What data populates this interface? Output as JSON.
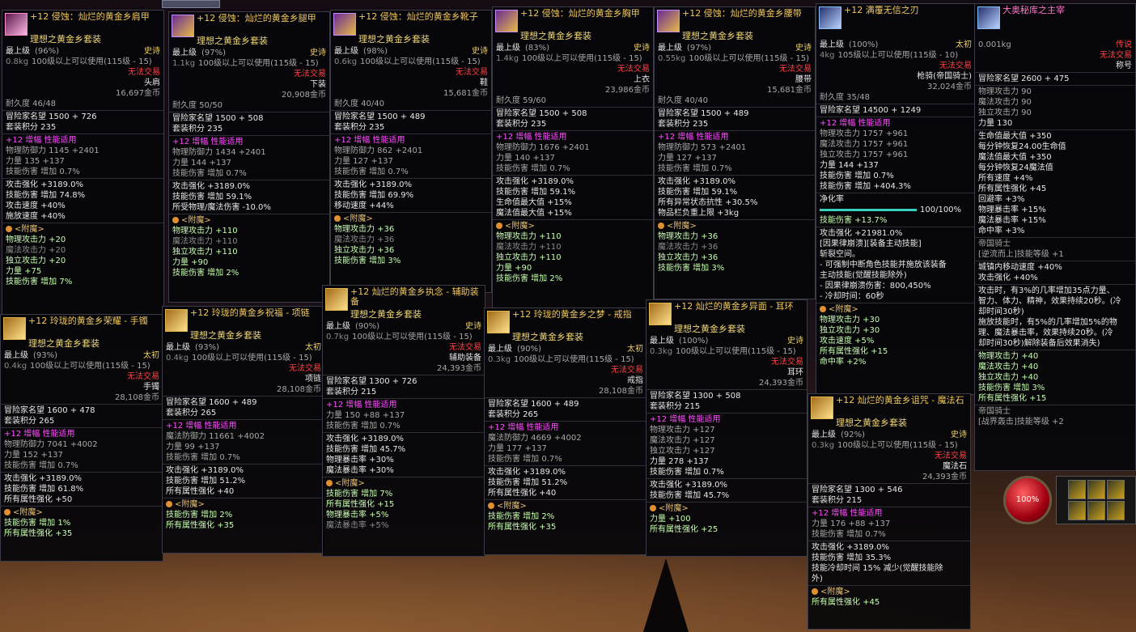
{
  "hud": {
    "hp_percent": "100%"
  },
  "items": [
    {
      "name": "+12 侵蚀：灿烂的黄金乡肩甲",
      "set": "理想之黄金乡套装",
      "level": "最上级",
      "quality": "(96%)",
      "grade": "史诗",
      "weight": "0.8kg",
      "req": "100级以上可以使用(115级 - 15)",
      "trade": "无法交易",
      "slot": "头肩",
      "price": "16,697金币",
      "durability": "耐久度 46/48",
      "fame": "冒险家名望 1500 + 726",
      "setpts": "套装积分 235",
      "amp_head": "+12 增幅  性能适用",
      "stats": [
        "物理防御力 1145 +2401",
        "力量 135 +137",
        "技能伤害 增加 0.7%"
      ],
      "attrs": [
        "攻击强化 +3189.0%",
        "技能伤害 增加 74.8%",
        "攻击速度 +40%",
        "施放速度 +40%"
      ],
      "ench_title": "<附魔>",
      "ench": [
        "物理攻击力 +20",
        "魔法攻击力 +20",
        "独立攻击力 +20",
        "力量 +75",
        "技能伤害 增加 7%"
      ]
    },
    {
      "name": "+12 侵蚀：灿烂的黄金乡腿甲",
      "set": "理想之黄金乡套装",
      "level": "最上级",
      "quality": "(97%)",
      "grade": "史诗",
      "weight": "1.1kg",
      "req": "100级以上可以使用(115级 - 15)",
      "trade": "无法交易",
      "slot": "下装",
      "price": "20,908金币",
      "durability": "耐久度 50/50",
      "fame": "冒险家名望 1500 + 508",
      "setpts": "套装积分 235",
      "amp_head": "+12 增幅  性能适用",
      "stats": [
        "物理防御力 1434 +2401",
        "力量 144 +137",
        "技能伤害 增加 0.7%"
      ],
      "attrs": [
        "攻击强化 +3189.0%",
        "技能伤害 增加 59.1%",
        "所受物理/魔法伤害 -10.0%"
      ],
      "ench_title": "<附魔>",
      "ench": [
        "物理攻击力 +110",
        "魔法攻击力 +110",
        "独立攻击力 +110",
        "力量 +90",
        "技能伤害 增加 2%"
      ]
    },
    {
      "name": "+12 侵蚀：灿烂的黄金乡靴子",
      "set": "理想之黄金乡套装",
      "level": "最上级",
      "quality": "(98%)",
      "grade": "史诗",
      "weight": "0.6kg",
      "req": "100级以上可以使用(115级 - 15)",
      "trade": "无法交易",
      "slot": "鞋",
      "price": "15,681金币",
      "durability": "耐久度 40/40",
      "fame": "冒险家名望 1500 + 489",
      "setpts": "套装积分 235",
      "amp_head": "+12 增幅  性能适用",
      "stats": [
        "物理防御力 862 +2401",
        "力量 127 +137",
        "技能伤害 增加 0.7%"
      ],
      "attrs": [
        "攻击强化 +3189.0%",
        "技能伤害 增加 69.9%",
        "移动速度 +44%"
      ],
      "ench_title": "<附魔>",
      "ench": [
        "物理攻击力 +36",
        "魔法攻击力 +36",
        "独立攻击力 +36",
        "技能伤害 增加 3%"
      ]
    },
    {
      "name": "+12 侵蚀：灿烂的黄金乡胸甲",
      "set": "理想之黄金乡套装",
      "level": "最上级",
      "quality": "(83%)",
      "grade": "史诗",
      "weight": "1.4kg",
      "req": "100级以上可以使用(115级 - 15)",
      "trade": "无法交易",
      "slot": "上衣",
      "price": "23,986金币",
      "durability": "耐久度 59/60",
      "fame": "冒险家名望 1500 + 508",
      "setpts": "套装积分 235",
      "amp_head": "+12 增幅  性能适用",
      "stats": [
        "物理防御力 1676 +2401",
        "力量 140 +137",
        "技能伤害 增加 0.7%"
      ],
      "attrs": [
        "攻击强化 +3189.0%",
        "技能伤害 增加 59.1%",
        "生命值最大值 +15%",
        "魔法值最大值 +15%"
      ],
      "ench_title": "<附魔>",
      "ench": [
        "物理攻击力 +110",
        "魔法攻击力 +110",
        "独立攻击力 +110",
        "力量 +90",
        "技能伤害 增加 2%"
      ]
    },
    {
      "name": "+12 侵蚀：灿烂的黄金乡腰带",
      "set": "理想之黄金乡套装",
      "level": "最上级",
      "quality": "(97%)",
      "grade": "史诗",
      "weight": "0.55kg",
      "req": "100级以上可以使用(115级 - 15)",
      "trade": "无法交易",
      "slot": "腰带",
      "price": "15,681金币",
      "durability": "耐久度 40/40",
      "fame": "冒险家名望 1500 + 489",
      "setpts": "套装积分 235",
      "amp_head": "+12 增幅  性能适用",
      "stats": [
        "物理防御力 573 +2401",
        "力量 127 +137",
        "技能伤害 增加 0.7%"
      ],
      "attrs": [
        "攻击强化 +3189.0%",
        "技能伤害 增加 59.1%",
        "所有异常状态抗性 +30.5%",
        "物品栏负重上限 +3kg"
      ],
      "ench_title": "<附魔>",
      "ench": [
        "物理攻击力 +36",
        "魔法攻击力 +36",
        "独立攻击力 +36",
        "技能伤害 增加 3%"
      ]
    },
    {
      "name": "+12 满覆无信之刃",
      "set": "",
      "level": "最上级",
      "quality": "(100%)",
      "grade": "太初",
      "weight": "4kg",
      "req": "105级以上可以使用(115级 - 10)",
      "trade": "无法交易",
      "slot": "枪骑(帝国骑士)",
      "price": "32,024金币",
      "durability": "耐久度 35/48",
      "fame": "冒险家名望 14500 + 1249",
      "amp_head": "+12 增幅  性能适用",
      "stats": [
        "物理攻击力 1757 +961",
        "魔法攻击力 1757 +961",
        "独立攻击力 1757 +961",
        "力量 144 +137",
        "技能伤害 增加 0.7%",
        "技能伤害 增加 +404.3%"
      ],
      "purify": "净化率",
      "purify_val": "100/100%",
      "purify_skill": "技能伤害 +13.7%",
      "attrs": [
        "攻击强化 +21981.0%",
        "[因果律崩溃][装备主动技能]",
        "斩裂空间。",
        "- 可强制中断角色技能并施放该装备",
        "主动技能(觉醒技能除外)",
        "- 因果律崩溃伤害：800,450%",
        "- 冷却时间：60秒"
      ],
      "ench_title": "<附魔>",
      "ench": [
        "物理攻击力 +30",
        "独立攻击力 +30",
        "攻击速度 +5%",
        "所有属性强化 +15",
        "命中率 +2%"
      ]
    },
    {
      "name": "大奥秘库之主宰",
      "grade": "传说",
      "weight": "0.001kg",
      "trade": "无法交易",
      "slot": "称号",
      "fame": "冒险家名望 2600 + 475",
      "stats": [
        "物理攻击力 90",
        "魔法攻击力 90",
        "独立攻击力 90",
        "力量 130"
      ],
      "attrs": [
        "生命值最大值 +350",
        "每分钟恢复24.00生命值",
        "魔法值最大值 +350",
        "每分钟恢复24魔法值",
        "所有速度 +4%",
        "所有属性强化 +45",
        "回避率 +3%",
        "物理暴击率 +15%",
        "魔法暴击率 +15%",
        "命中率 +3%"
      ],
      "class1": "帝国骑士",
      "class1_skill": "[逆流而上]技能等级 +1",
      "town": [
        "城镇内移动速度 +40%",
        "攻击强化 +40%"
      ],
      "proc": [
        "攻击时，有3%的几率增加35点力量、",
        "智力、体力、精神，效果持续20秒。(冷",
        "却时间30秒)",
        "施放技能时，有5%的几率增加5%的物",
        "理、魔法暴击率，效果持续20秒。(冷",
        "却时间30秒)解除装备后效果消失)"
      ],
      "ench": [
        "物理攻击力 +40",
        "魔法攻击力 +40",
        "独立攻击力 +40",
        "技能伤害 增加 3%",
        "所有属性强化 +15"
      ],
      "class2": "帝国骑士",
      "class2_skill": "[战界轰击]技能等级 +2"
    },
    {
      "name": "+12 玲珑的黄金乡荣耀 - 手镯",
      "set": "理想之黄金乡套装",
      "level": "最上级",
      "quality": "(93%)",
      "grade": "太初",
      "weight": "0.4kg",
      "req": "100级以上可以使用(115级 - 15)",
      "trade": "无法交易",
      "slot": "手镯",
      "price": "28,108金币",
      "fame": "冒险家名望 1600 + 478",
      "setpts": "套装积分 265",
      "amp_head": "+12 增幅  性能适用",
      "stats": [
        "物理防御力 7041 +4002",
        "力量 152 +137",
        "技能伤害 增加 0.7%"
      ],
      "attrs": [
        "攻击强化 +3189.0%",
        "技能伤害 增加 61.8%",
        "所有属性强化 +50"
      ],
      "ench_title": "<附魔>",
      "ench": [
        "技能伤害 增加 1%",
        "所有属性强化 +35"
      ]
    },
    {
      "name": "+12 玲珑的黄金乡祝福 - 项链",
      "set": "理想之黄金乡套装",
      "level": "最上级",
      "quality": "(93%)",
      "grade": "太初",
      "weight": "0.4kg",
      "req": "100级以上可以使用(115级 - 15)",
      "trade": "无法交易",
      "slot": "项链",
      "price": "28,108金币",
      "fame": "冒险家名望 1600 + 489",
      "setpts": "套装积分 265",
      "amp_head": "+12 增幅  性能适用",
      "stats": [
        "魔法防御力 11661 +4002",
        "力量 99 +137",
        "技能伤害 增加 0.7%"
      ],
      "attrs": [
        "攻击强化 +3189.0%",
        "技能伤害 增加 51.2%",
        "所有属性强化 +40"
      ],
      "ench_title": "<附魔>",
      "ench": [
        "技能伤害 增加 2%",
        "所有属性强化 +35"
      ]
    },
    {
      "name": "+12 灿烂的黄金乡执念 - 辅助装备",
      "set": "理想之黄金乡套装",
      "level": "最上级",
      "quality": "(90%)",
      "grade": "史诗",
      "weight": "0.7kg",
      "req": "100级以上可以使用(115级 - 15)",
      "trade": "无法交易",
      "slot": "辅助装备",
      "price": "24,393金币",
      "fame": "冒险家名望 1300 + 726",
      "setpts": "套装积分 215",
      "amp_head": "+12 增幅  性能适用",
      "stats": [
        "力量 150 +88 +137",
        "技能伤害 增加 0.7%"
      ],
      "attrs": [
        "攻击强化 +3189.0%",
        "技能伤害 增加 45.7%",
        "物理暴击率 +30%",
        "魔法暴击率 +30%"
      ],
      "ench_title": "<附魔>",
      "ench": [
        "技能伤害 增加 7%",
        "所有属性强化 +15",
        "物理暴击率 +5%",
        "魔法暴击率 +5%"
      ]
    },
    {
      "name": "+12 玲珑的黄金乡之梦 - 戒指",
      "set": "理想之黄金乡套装",
      "level": "最上级",
      "quality": "(90%)",
      "grade": "太初",
      "weight": "0.3kg",
      "req": "100级以上可以使用(115级 - 15)",
      "trade": "无法交易",
      "slot": "戒指",
      "price": "28,108金币",
      "fame": "冒险家名望 1600 + 489",
      "setpts": "套装积分 265",
      "amp_head": "+12 增幅  性能适用",
      "stats": [
        "魔法防御力 4669 +4002",
        "力量 177 +137",
        "技能伤害 增加 0.7%"
      ],
      "attrs": [
        "攻击强化 +3189.0%",
        "技能伤害 增加 51.2%",
        "所有属性强化 +40"
      ],
      "ench_title": "<附魔>",
      "ench": [
        "技能伤害 增加 2%",
        "所有属性强化 +35"
      ]
    },
    {
      "name": "+12 灿烂的黄金乡异面 - 耳环",
      "set": "理想之黄金乡套装",
      "level": "最上级",
      "quality": "(100%)",
      "grade": "史诗",
      "weight": "0.3kg",
      "req": "100级以上可以使用(115级 - 15)",
      "trade": "无法交易",
      "slot": "耳环",
      "price": "24,393金币",
      "fame": "冒险家名望 1300 + 508",
      "setpts": "套装积分 215",
      "amp_head": "+12 增幅  性能适用",
      "stats": [
        "物理攻击力 +127",
        "魔法攻击力 +127",
        "独立攻击力 +127",
        "力量 278 +137",
        "技能伤害 增加 0.7%"
      ],
      "attrs": [
        "攻击强化 +3189.0%",
        "技能伤害 增加 45.7%"
      ],
      "ench_title": "<附魔>",
      "ench": [
        "力量 +100",
        "所有属性强化 +25"
      ]
    },
    {
      "name": "+12 灿烂的黄金乡诅咒 - 魔法石",
      "set": "理想之黄金乡套装",
      "level": "最上级",
      "quality": "(92%)",
      "grade": "史诗",
      "weight": "0.3kg",
      "req": "100级以上可以使用(115级 - 15)",
      "trade": "无法交易",
      "slot": "魔法石",
      "price": "24,393金币",
      "fame": "冒险家名望 1300 + 546",
      "setpts": "套装积分 215",
      "amp_head": "+12 增幅  性能适用",
      "stats": [
        "力量 176 +88 +137",
        "技能伤害 增加 0.7%"
      ],
      "attrs": [
        "攻击强化 +3189.0%",
        "技能伤害 增加 35.3%",
        "技能冷却时间 15% 减少(觉醒技能除",
        "外)"
      ],
      "ench_title": "<附魔>",
      "ench": [
        "所有属性强化 +45"
      ]
    }
  ]
}
